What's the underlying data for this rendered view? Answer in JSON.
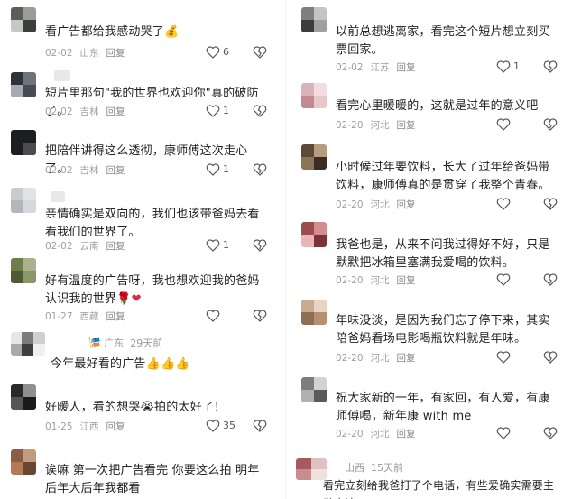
{
  "left": [
    {
      "text": "看广告都给我感动哭了",
      "emoji": "💰",
      "date": "02-02",
      "loc": "山东",
      "reply": "回复",
      "likes": "6"
    },
    {
      "text": "短片里那句\"我的世界也欢迎你\"真的破防了。",
      "date": "02-02",
      "loc": "吉林",
      "reply": "回复",
      "likes": "1"
    },
    {
      "text": "把陪伴讲得这么透彻，康师傅这次走心了。",
      "date": "02-02",
      "loc": "吉林",
      "reply": "回复",
      "likes": "1"
    },
    {
      "text": "亲情确实是双向的，我们也该带爸妈去看看我们的世界了。",
      "date": "02-02",
      "loc": "云南",
      "reply": "回复",
      "likes": "1"
    },
    {
      "text": "好有温度的广告呀，我也想欢迎我的爸妈认识我的世界",
      "emoji": "🌹❤",
      "date": "01-27",
      "loc": "西藏",
      "reply": "回复",
      "likes": ""
    },
    {
      "tag": "广东",
      "time": "29天前",
      "text": "今年最好看的广告",
      "emoji": "👍👍👍"
    },
    {
      "text": "好暖人，看的想哭",
      "emoji": "😭",
      "text2": "拍的太好了！",
      "date": "01-25",
      "loc": "江西",
      "reply": "回复",
      "likes": "35"
    },
    {
      "text": "诶嘛 第一次把广告看完 你要这么拍 明年后年大后年我都看"
    }
  ],
  "right": [
    {
      "text": "以前总想逃离家，看完这个短片想立刻买票回家。",
      "date": "02-02",
      "loc": "江苏",
      "reply": "回复",
      "likes": "1"
    },
    {
      "text": "看完心里暖暖的，这就是过年的意义吧",
      "date": "02-20",
      "loc": "河北",
      "reply": "回复",
      "likes": ""
    },
    {
      "text": "小时候过年要饮料，长大了过年给爸妈带饮料，康师傅真的是贯穿了我整个青春。",
      "date": "02-20",
      "loc": "河北",
      "reply": "回复",
      "likes": ""
    },
    {
      "text": "我爸也是，从来不问我过得好不好，只是默默把冰箱里塞满我爱喝的饮料。",
      "date": "02-20",
      "loc": "河北",
      "reply": "回复",
      "likes": ""
    },
    {
      "text": "年味没淡，是因为我们忘了停下来，其实陪爸妈看场电影喝瓶饮料就是年味。",
      "date": "02-20",
      "loc": "河北",
      "reply": "回复",
      "likes": ""
    },
    {
      "text": "祝大家新的一年，有家回，有人爱，有康师傅喝，新年康 with me",
      "date": "02-20",
      "loc": "河北",
      "reply": "回复",
      "likes": ""
    },
    {
      "tag": "山西",
      "time": "15天前",
      "text": "看完立刻给我爸打了个电话，有些爱确实需要主动表达。"
    }
  ],
  "colors": {
    "text": "#222222",
    "meta": "#a0a0a0",
    "tag_accent": "#e6a400"
  }
}
